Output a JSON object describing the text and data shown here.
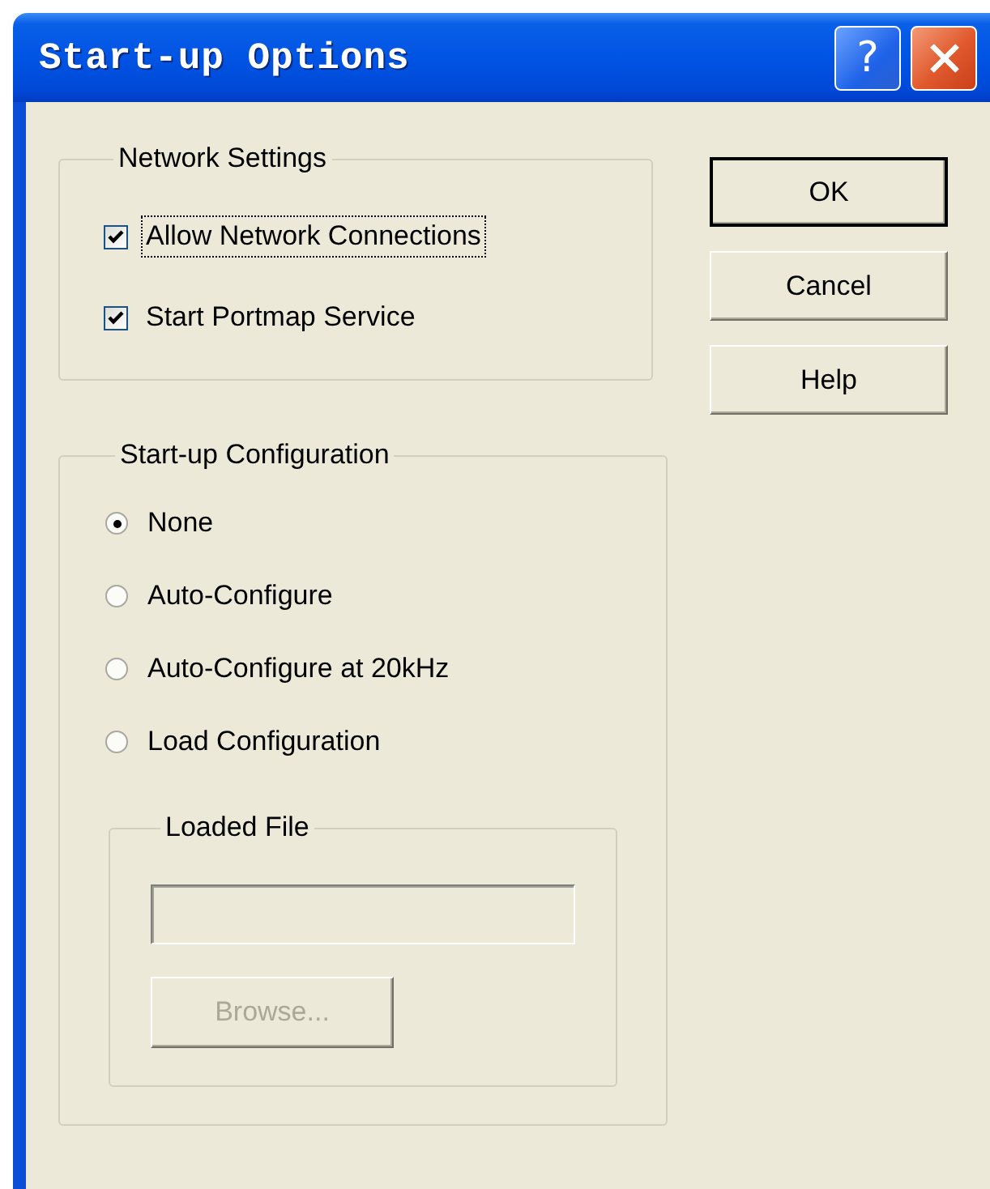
{
  "window": {
    "title": "Start-up Options",
    "help_button": {
      "label": "?"
    }
  },
  "network_settings": {
    "legend": "Network Settings",
    "checkboxes": [
      {
        "label": "Allow Network Connections",
        "checked": true,
        "focused": true
      },
      {
        "label": "Start Portmap Service",
        "checked": true,
        "focused": false
      }
    ]
  },
  "startup_configuration": {
    "legend": "Start-up Configuration",
    "radios": [
      {
        "label": "None",
        "selected": true
      },
      {
        "label": "Auto-Configure",
        "selected": false
      },
      {
        "label": "Auto-Configure at 20kHz",
        "selected": false
      },
      {
        "label": "Load Configuration",
        "selected": false
      }
    ],
    "loaded_file": {
      "legend": "Loaded File",
      "field": {
        "disabled": true
      },
      "browse_button": {
        "label": "Browse...",
        "disabled": true
      }
    }
  },
  "buttons": [
    {
      "label": "OK",
      "default": true
    },
    {
      "label": "Cancel",
      "default": false
    },
    {
      "label": "Help",
      "default": false
    }
  ]
}
